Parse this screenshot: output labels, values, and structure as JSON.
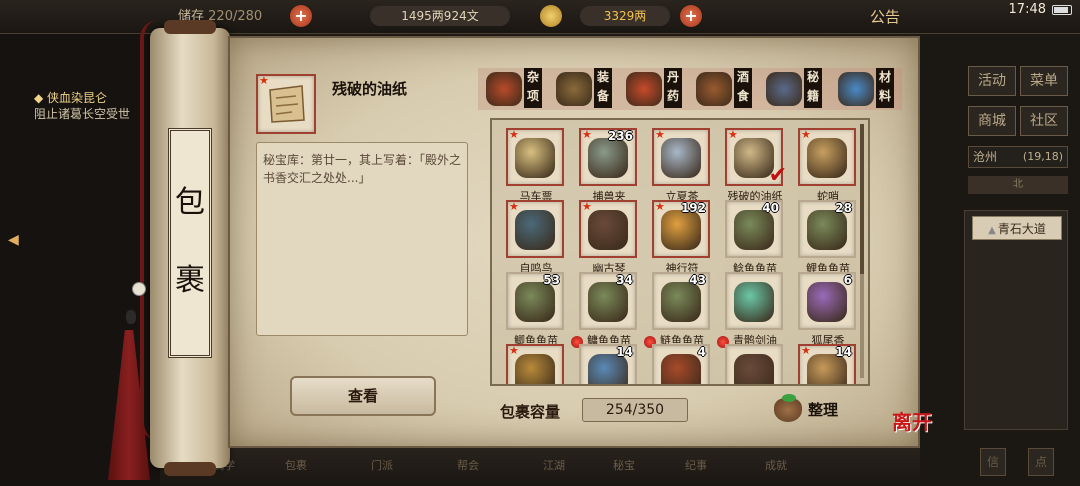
{
  "topbar": {
    "capacity_label": "储存",
    "capacity": "220/280",
    "money": "1495两924文",
    "gold": "3329两",
    "announcement": "公告",
    "time": "17:48"
  },
  "quest": {
    "title": "◆ 侠血染昆仑",
    "desc": "阻止诸葛长空受世"
  },
  "right_panel": {
    "buttons": [
      "活动",
      "菜单",
      "商城",
      "社区"
    ],
    "location": "沧州",
    "coords": "(19,18)",
    "compass": "北",
    "road": "青石大道"
  },
  "bottom_bar": {
    "items": [
      "武学",
      "包裹",
      "门派",
      "帮会",
      "江湖",
      "秘宝",
      "纪事",
      "成就"
    ],
    "right_buttons": [
      "信",
      "点"
    ]
  },
  "scroll": {
    "title_chars": [
      "包",
      "裹"
    ]
  },
  "selected": {
    "name": "残破的油纸",
    "description": "秘宝库：第廿一，其上写着：「殿外之书香交汇之处处...」",
    "view_label": "查看"
  },
  "categories": [
    {
      "label": "杂项",
      "icon": "sundries-icon",
      "color": "#b84a2a",
      "active": true
    },
    {
      "label": "装备",
      "icon": "equipment-icon",
      "color": "#8a6a3a",
      "active": false
    },
    {
      "label": "丹药",
      "icon": "medicine-icon",
      "color": "#c84a2a",
      "active": false
    },
    {
      "label": "酒食",
      "icon": "food-icon",
      "color": "#9a5a30",
      "active": false
    },
    {
      "label": "秘籍",
      "icon": "book-icon",
      "color": "#5a6a8a",
      "active": false
    },
    {
      "label": "材料",
      "icon": "material-icon",
      "color": "#4a8ac8",
      "active": false
    }
  ],
  "grid": [
    {
      "name": "马车票",
      "count": "",
      "star": true,
      "icon": "ticket-icon",
      "color": "#d8c080",
      "dot": false,
      "check": false
    },
    {
      "name": "捕兽夹",
      "count": "236",
      "star": true,
      "icon": "trap-icon",
      "color": "#8a9a8a",
      "dot": false,
      "check": false
    },
    {
      "name": "立夏茶",
      "count": "",
      "star": true,
      "icon": "tea-icon",
      "color": "#a8b8c8",
      "dot": false,
      "check": false
    },
    {
      "name": "残破的油纸",
      "count": "",
      "star": true,
      "icon": "paper-icon",
      "color": "#d0b888",
      "dot": false,
      "check": true
    },
    {
      "name": "蛇哨",
      "count": "",
      "star": true,
      "icon": "whistle-icon",
      "color": "#c8a060",
      "dot": false,
      "check": false
    },
    {
      "name": "自鸣鸟",
      "count": "",
      "star": true,
      "icon": "bird-icon",
      "color": "#4a6a7a",
      "dot": false,
      "check": false
    },
    {
      "name": "幽古琴",
      "count": "",
      "star": true,
      "icon": "zither-icon",
      "color": "#6a4a3a",
      "dot": false,
      "check": false
    },
    {
      "name": "神行符",
      "count": "192",
      "star": true,
      "icon": "talisman-icon",
      "color": "#e0a040",
      "dot": false,
      "check": false
    },
    {
      "name": "鲶鱼鱼苗",
      "count": "40",
      "star": false,
      "icon": "fish-basket-icon",
      "color": "#7a8a5a",
      "dot": false,
      "check": false
    },
    {
      "name": "鲤鱼鱼苗",
      "count": "28",
      "star": false,
      "icon": "fish-basket-icon",
      "color": "#7a8a5a",
      "dot": false,
      "check": false
    },
    {
      "name": "鲫鱼鱼苗",
      "count": "53",
      "star": false,
      "icon": "fish-basket-icon",
      "color": "#7a8a5a",
      "dot": false,
      "check": false
    },
    {
      "name": "鳙鱼鱼苗",
      "count": "34",
      "star": false,
      "icon": "fish-basket-icon",
      "color": "#7a8a5a",
      "dot": false,
      "check": false
    },
    {
      "name": "鲢鱼鱼苗",
      "count": "43",
      "star": false,
      "icon": "fish-basket-icon",
      "color": "#7a8a5a",
      "dot": false,
      "check": false
    },
    {
      "name": "青鹘剑油",
      "count": "",
      "star": false,
      "icon": "jar-icon",
      "color": "#6ac8a8",
      "dot": false,
      "check": false
    },
    {
      "name": "狐尾香",
      "count": "6",
      "star": false,
      "icon": "incense-icon",
      "color": "#9a6ab8",
      "dot": false,
      "check": false
    },
    {
      "name": "",
      "count": "",
      "star": true,
      "icon": "box-icon",
      "color": "#b88a3a",
      "dot": false,
      "check": false
    },
    {
      "name": "",
      "count": "14",
      "star": false,
      "icon": "crystal-icon",
      "color": "#5a8ab8",
      "dot": true,
      "check": false
    },
    {
      "name": "",
      "count": "4",
      "star": false,
      "icon": "chest-icon",
      "color": "#a84a2a",
      "dot": true,
      "check": false
    },
    {
      "name": "",
      "count": "",
      "star": false,
      "icon": "armor-icon",
      "color": "#6a4a3a",
      "dot": true,
      "check": false
    },
    {
      "name": "",
      "count": "14",
      "star": true,
      "icon": "torch-icon",
      "color": "#c89a5a",
      "dot": false,
      "check": false
    }
  ],
  "capacity": {
    "label": "包裹容量",
    "value": "254/350"
  },
  "sort_label": "整理",
  "leave_label": "离开"
}
